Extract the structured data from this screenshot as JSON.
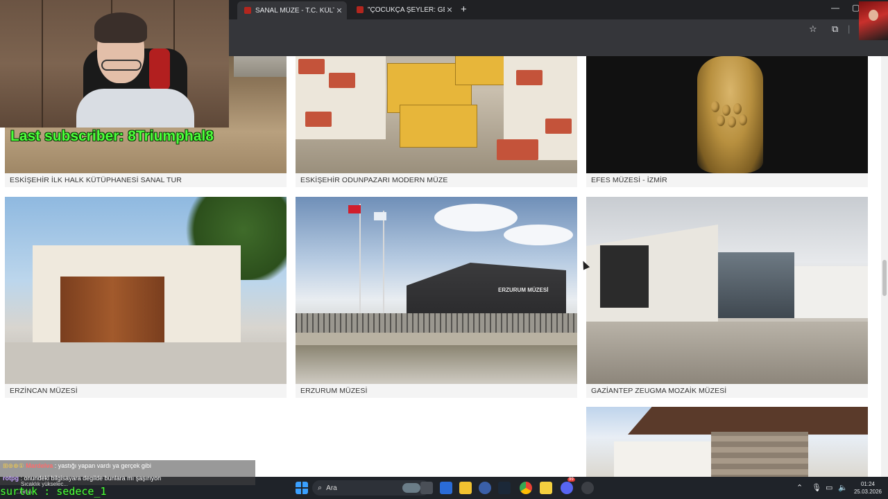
{
  "browser": {
    "tabs": [
      {
        "label": "SANAL MÜZE - T.C. KÜLTÜR VE",
        "active": true
      },
      {
        "label": "\"ÇOCUKÇA ŞEYLER: GEÇMİŞTEN",
        "active": false
      }
    ],
    "new_tab": "+",
    "tab_close": "✕",
    "window_minimize": "—",
    "window_maximize": "▢"
  },
  "museums": [
    {
      "title": "ESKİŞEHİR İLK HALK KÜTÜPHANESİ SANAL TUR"
    },
    {
      "title": "ESKİŞEHİR ODUNPAZARI MODERN MÜZE"
    },
    {
      "title": "EFES MÜZESİ - İZMİR"
    },
    {
      "title": "ERZİNCAN MÜZESİ"
    },
    {
      "title": "ERZURUM MÜZESİ",
      "sign": "ERZURUM MÜZESİ"
    },
    {
      "title": "GAZİANTEP ZEUGMA MOZAİK MÜZESİ"
    },
    {
      "title": ""
    }
  ],
  "overlay": {
    "subscriber_text": "Last subscriber: 8Triumphal8",
    "chat": [
      {
        "user": "Mardelva",
        "message": ": yastığı yapan vardı ya gerçek gibi"
      },
      {
        "user": "rotpg",
        "message": ": onundeki bilgisayara degilde bunlara mı şaşırıyon"
      }
    ],
    "weather_line1": "Sıcaklık yükselec...",
    "weather_line2": "...lama",
    "command_text": "surtuk : sedece_1"
  },
  "taskbar": {
    "search_placeholder": "Ara",
    "time": "01:24",
    "date": "25.03.2026",
    "badge_count": "99"
  },
  "colors": {
    "overlay_green": "#4dff3b",
    "chrome_dark": "#202124",
    "taskbar": "#1f2329"
  }
}
